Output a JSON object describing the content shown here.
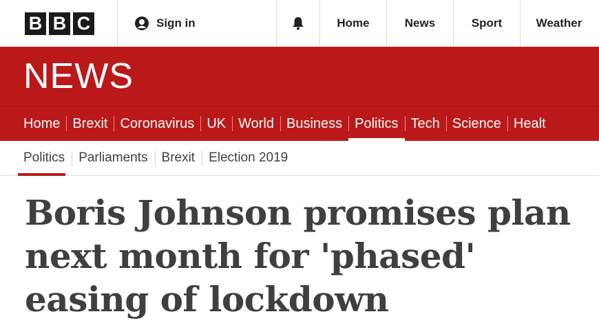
{
  "logo": {
    "letters": [
      "B",
      "B",
      "C"
    ]
  },
  "account": {
    "sign_in_label": "Sign in",
    "icon": "user-icon"
  },
  "notifications": {
    "icon": "bell-icon"
  },
  "top_nav": [
    "Home",
    "News",
    "Sport",
    "Weather"
  ],
  "banner": {
    "title": "NEWS"
  },
  "section_nav": {
    "items": [
      "Home",
      "Brexit",
      "Coronavirus",
      "UK",
      "World",
      "Business",
      "Politics",
      "Tech",
      "Science",
      "Healt"
    ],
    "active": "Politics"
  },
  "sub_nav": {
    "items": [
      "Politics",
      "Parliaments",
      "Brexit",
      "Election 2019"
    ],
    "active": "Politics"
  },
  "article": {
    "headline": "Boris Johnson promises plan next month for 'phased' easing of lockdown"
  },
  "colors": {
    "brand_red": "#bb1919",
    "headline_text": "#3f3f42"
  }
}
